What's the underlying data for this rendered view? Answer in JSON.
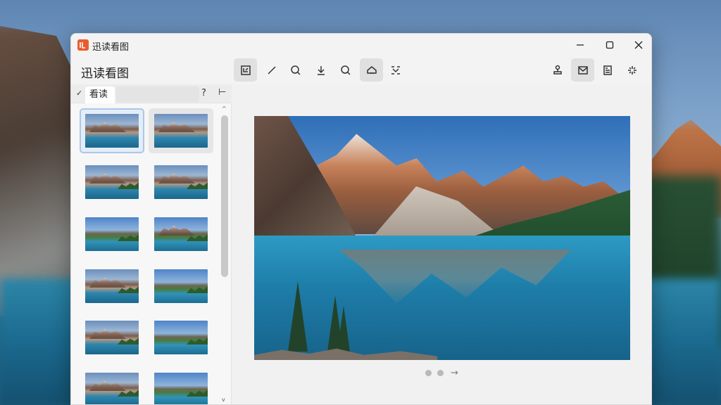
{
  "window": {
    "title": "迅读看图",
    "app_name": "迅读看图",
    "logo_glyph": "JPG",
    "controls": {
      "minimize": "—",
      "maximize": "☐",
      "close": "✕"
    }
  },
  "toolbar": {
    "tools": [
      {
        "name": "crop-icon",
        "active": true
      },
      {
        "name": "draw-line-icon",
        "active": false
      },
      {
        "name": "zoom-icon",
        "active": false
      },
      {
        "name": "download-icon",
        "active": false
      },
      {
        "name": "search-icon",
        "active": false
      },
      {
        "name": "rotate-icon",
        "active": true
      },
      {
        "name": "transform-icon",
        "active": false
      }
    ],
    "right_tools": [
      {
        "name": "stamp-icon",
        "active": false
      },
      {
        "name": "mail-icon",
        "active": true
      },
      {
        "name": "layout-icon",
        "active": false
      },
      {
        "name": "sparkle-icon",
        "active": false
      }
    ]
  },
  "sidebar": {
    "check_glyph": "✓",
    "tab_label": "看读",
    "help_glyph": "?",
    "pin_glyph": "⊢",
    "thumbnails_count_visible": 12,
    "scroll_up": "^",
    "scroll_down": "v"
  },
  "viewer": {
    "pager_dots": 2,
    "next_glyph": "→"
  }
}
